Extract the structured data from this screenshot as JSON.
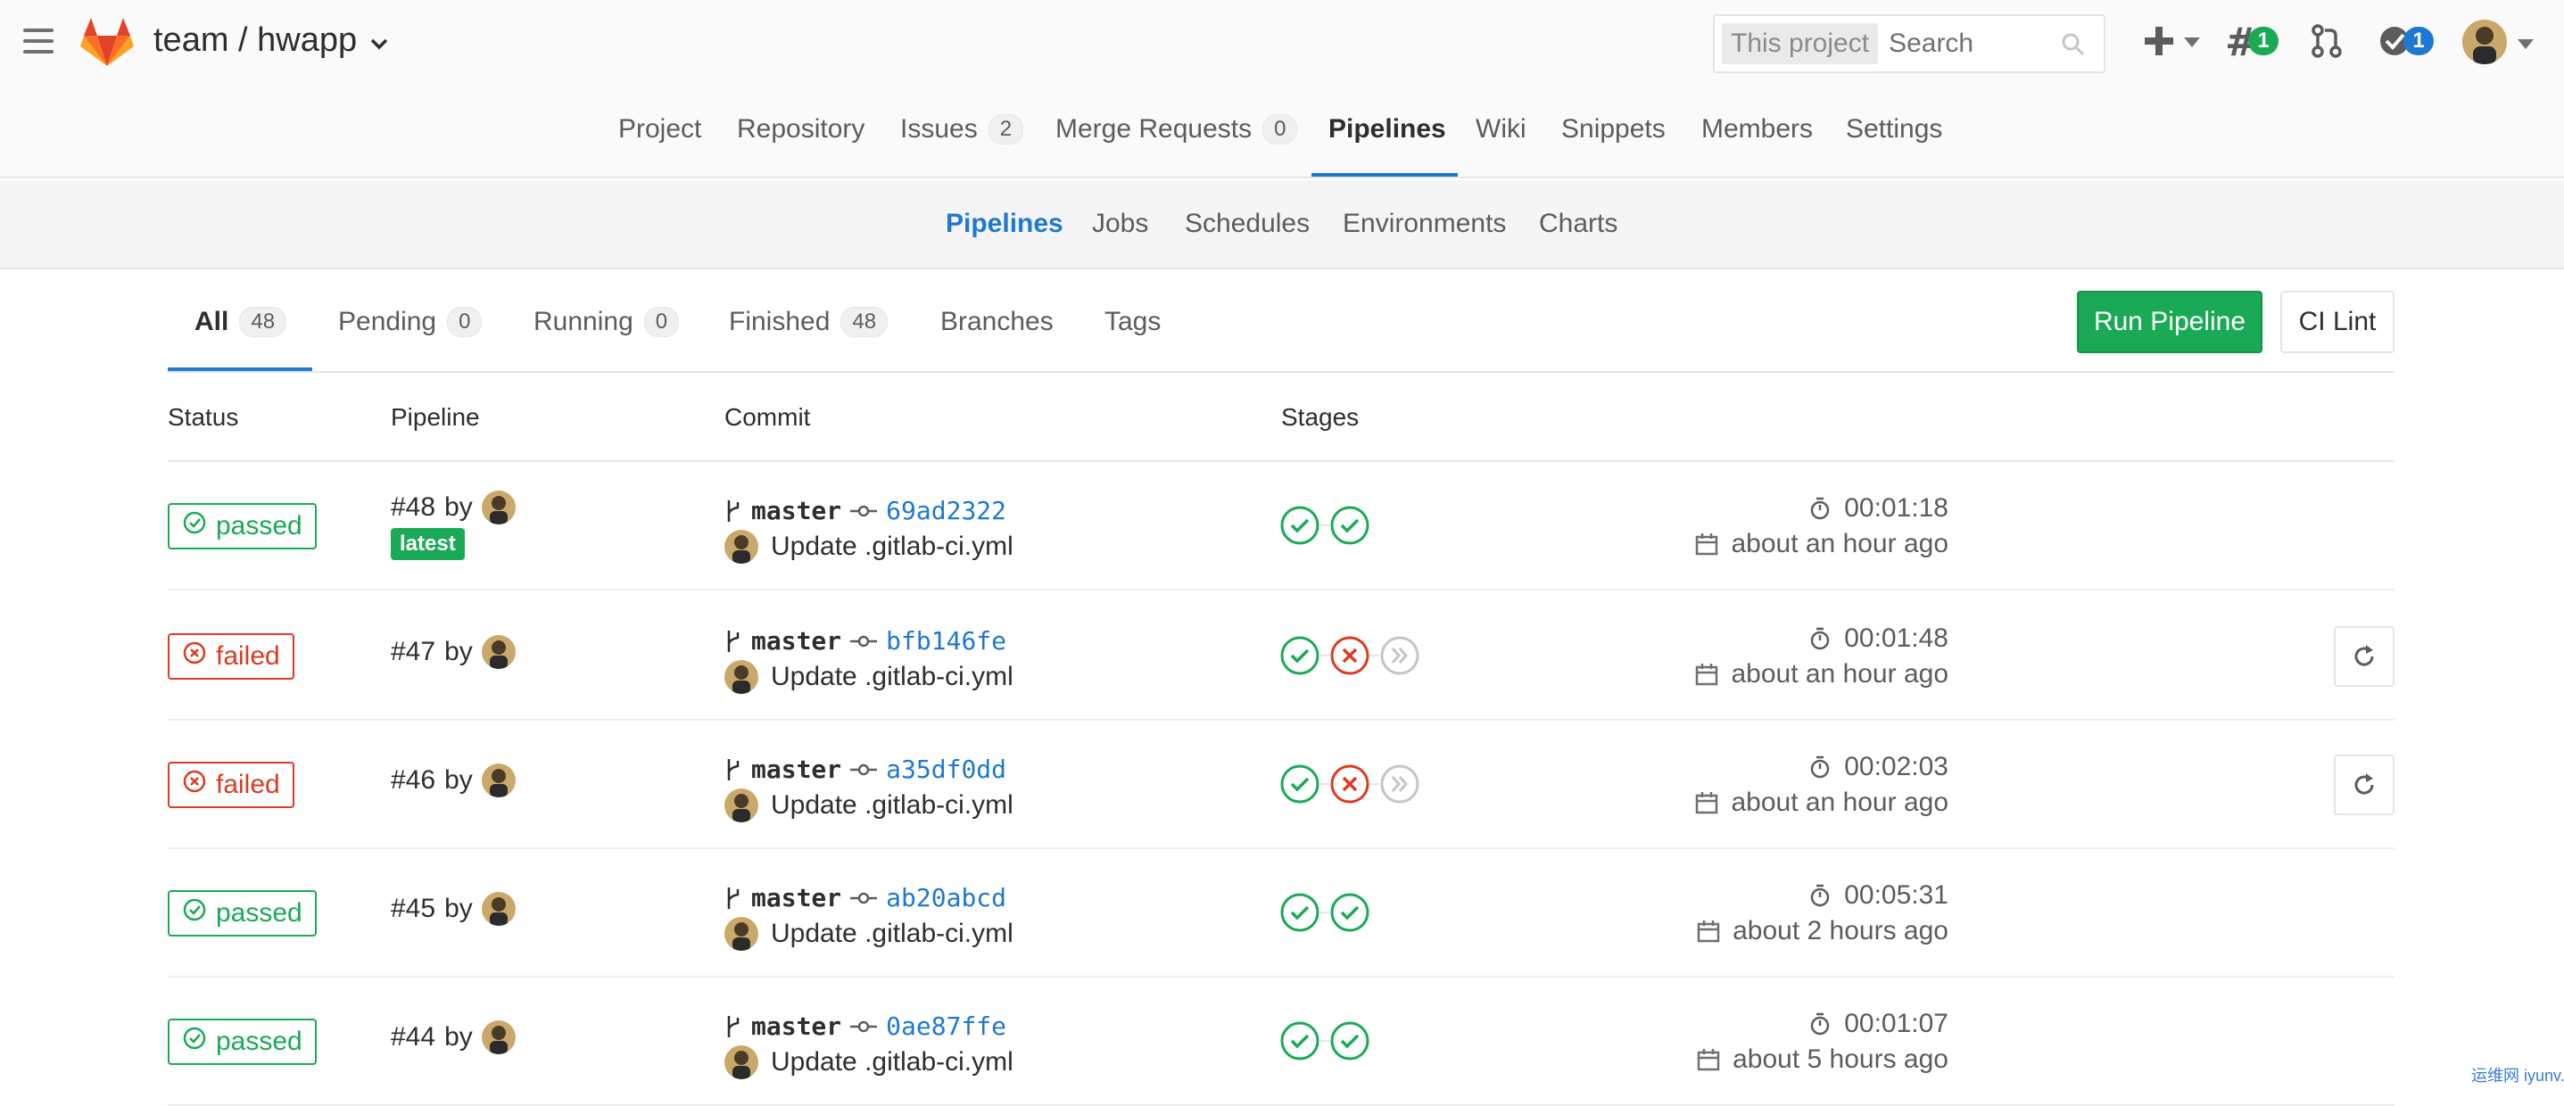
{
  "header": {
    "project": "team / hwapp",
    "search": {
      "scope": "This project",
      "placeholder": "Search"
    },
    "todos_count": "1",
    "issues_assigned_count": "1",
    "accent": "#1f78d1"
  },
  "main_nav": [
    {
      "label": "Project"
    },
    {
      "label": "Repository"
    },
    {
      "label": "Issues",
      "count": "2"
    },
    {
      "label": "Merge Requests",
      "count": "0"
    },
    {
      "label": "Pipelines",
      "active": true
    },
    {
      "label": "Wiki"
    },
    {
      "label": "Snippets"
    },
    {
      "label": "Members"
    },
    {
      "label": "Settings"
    }
  ],
  "sub_nav": [
    {
      "label": "Pipelines",
      "active": true
    },
    {
      "label": "Jobs"
    },
    {
      "label": "Schedules"
    },
    {
      "label": "Environments"
    },
    {
      "label": "Charts"
    }
  ],
  "tabs": [
    {
      "label": "All",
      "count": "48",
      "active": true
    },
    {
      "label": "Pending",
      "count": "0"
    },
    {
      "label": "Running",
      "count": "0"
    },
    {
      "label": "Finished",
      "count": "48"
    },
    {
      "label": "Branches"
    },
    {
      "label": "Tags"
    }
  ],
  "actions": {
    "run_pipeline": "Run Pipeline",
    "ci_lint": "CI Lint"
  },
  "columns": {
    "status": "Status",
    "pipeline": "Pipeline",
    "commit": "Commit",
    "stages": "Stages"
  },
  "pipelines": [
    {
      "status": "passed",
      "id": "#48",
      "by": "by",
      "latest": "latest",
      "branch": "master",
      "sha": "69ad2322",
      "message": "Update .gitlab-ci.yml",
      "stages": [
        "success",
        "success"
      ],
      "duration": "00:01:18",
      "finished": "about an hour ago",
      "retry": false
    },
    {
      "status": "failed",
      "id": "#47",
      "by": "by",
      "branch": "master",
      "sha": "bfb146fe",
      "message": "Update .gitlab-ci.yml",
      "stages": [
        "success",
        "failed",
        "skipped"
      ],
      "duration": "00:01:48",
      "finished": "about an hour ago",
      "retry": true
    },
    {
      "status": "failed",
      "id": "#46",
      "by": "by",
      "branch": "master",
      "sha": "a35df0dd",
      "message": "Update .gitlab-ci.yml",
      "stages": [
        "success",
        "failed",
        "skipped"
      ],
      "duration": "00:02:03",
      "finished": "about an hour ago",
      "retry": true
    },
    {
      "status": "passed",
      "id": "#45",
      "by": "by",
      "branch": "master",
      "sha": "ab20abcd",
      "message": "Update .gitlab-ci.yml",
      "stages": [
        "success",
        "success"
      ],
      "duration": "00:05:31",
      "finished": "about 2 hours ago",
      "retry": false
    },
    {
      "status": "passed",
      "id": "#44",
      "by": "by",
      "branch": "master",
      "sha": "0ae87ffe",
      "message": "Update .gitlab-ci.yml",
      "stages": [
        "success",
        "success"
      ],
      "duration": "00:01:07",
      "finished": "about 5 hours ago",
      "retry": false
    }
  ],
  "watermark": "运维网 iyunv.com"
}
